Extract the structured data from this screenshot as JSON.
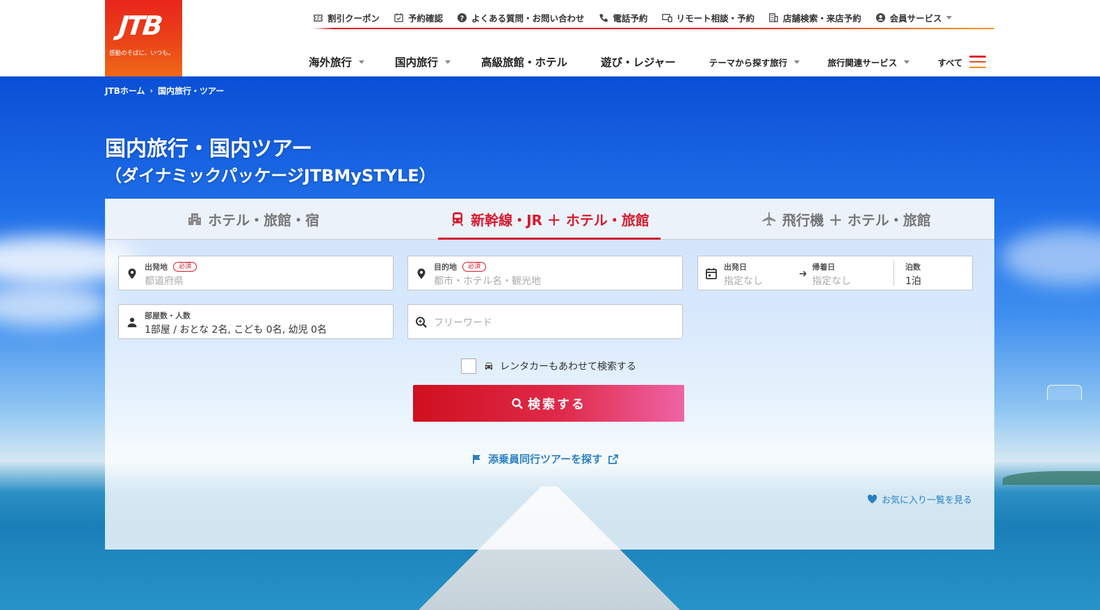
{
  "brand": {
    "logo_text": "JTB",
    "tagline": "感動のそばに、いつも。",
    "colors": {
      "accent": "#d61a2e",
      "link": "#2a80c4",
      "hero_blue": "#1f6fe8"
    }
  },
  "utility_nav": [
    {
      "label": "割引クーポン",
      "icon": "coupon-icon"
    },
    {
      "label": "予約確認",
      "icon": "calendar-check-icon"
    },
    {
      "label": "よくある質問・お問い合わせ",
      "icon": "question-icon"
    },
    {
      "label": "電話予約",
      "icon": "phone-icon"
    },
    {
      "label": "リモート相談・予約",
      "icon": "remote-icon"
    },
    {
      "label": "店舗検索・来店予約",
      "icon": "building-icon"
    },
    {
      "label": "会員サービス",
      "icon": "user-circle-icon"
    }
  ],
  "global_nav": [
    {
      "label": "海外旅行"
    },
    {
      "label": "国内旅行"
    },
    {
      "label": "高級旅館・ホテル"
    },
    {
      "label": "遊び・レジャー"
    },
    {
      "label": "テーマから探す旅行"
    },
    {
      "label": "旅行関連サービス"
    },
    {
      "label": "すべて"
    }
  ],
  "breadcrumb": [
    "JTBホーム",
    "国内旅行・ツアー"
  ],
  "breadcrumb_separator": "›",
  "page": {
    "title": "国内旅行・国内ツアー",
    "subtitle": "（ダイナミックパッケージJTBMySTYLE）"
  },
  "search": {
    "tabs": [
      {
        "label": "ホテル・旅館・宿",
        "icon": "hotel-icon",
        "active": false
      },
      {
        "label": "新幹線・JR ＋ ホテル・旅館",
        "icon": "train-icon",
        "active": true
      },
      {
        "label": "飛行機 ＋ ホテル・旅館",
        "icon": "airplane-icon",
        "active": false
      }
    ],
    "departure": {
      "label": "出発地",
      "required": "必須",
      "placeholder": "都道府県"
    },
    "destination": {
      "label": "目的地",
      "required": "必須",
      "placeholder": "都市・ホテル名・観光地"
    },
    "dates": {
      "depart_label": "出発日",
      "depart_value": "指定なし",
      "return_label": "帰着日",
      "return_value": "指定なし",
      "nights_label": "泊数",
      "nights_value": "1泊"
    },
    "guests": {
      "label": "部屋数・人数",
      "value": "1部屋 / おとな 2名, こども 0名, 幼児 0名"
    },
    "freeword": {
      "placeholder": "フリーワード"
    },
    "rental_car": {
      "label": "レンタカーもあわせて検索する",
      "checked": false
    },
    "submit_label": "検索する",
    "conductor_link": "添乗員同行ツアーを探す",
    "favorites_link": "お気に入り一覧を見る"
  }
}
